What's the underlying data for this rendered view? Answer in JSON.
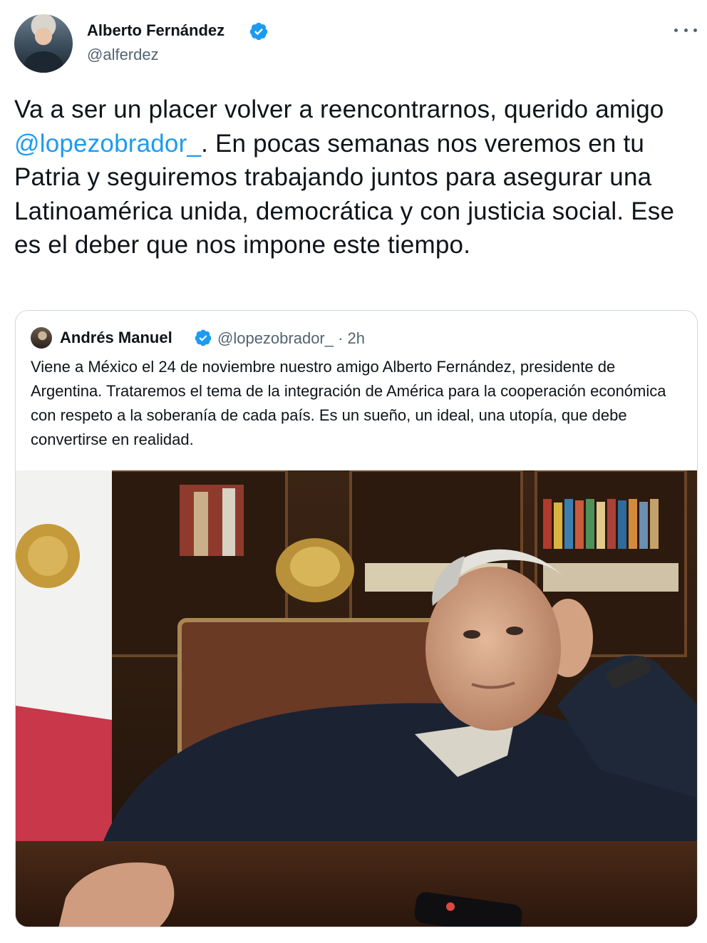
{
  "tweet": {
    "author_name": "Alberto Fernández",
    "author_handle": "@alferdez",
    "text_parts": {
      "before_mention": "Va a ser un placer volver a reencontrarnos, querido amigo ",
      "mention": "@lopezobrador_",
      "after_mention": ". En pocas semanas nos veremos en tu Patria y seguiremos trabajando juntos para asegurar una Latinoamérica unida, democrática y con justicia social. Ese es el deber que nos impone este tiempo."
    }
  },
  "quoted_tweet": {
    "author_name": "Andrés Manuel",
    "handle_time": "@lopezobrador_ · 2h",
    "text": "Viene a México el 24 de noviembre nuestro amigo Alberto Fernández, presidente de Argentina. Trataremos el tema de la integración de América para la cooperación económica con respeto a la soberanía de cada país. Es un sueño, un ideal, una utopía, que debe convertirse en realidad."
  },
  "icons": {
    "verified": "verified-badge-icon",
    "more": "more-options-icon"
  },
  "colors": {
    "accent": "#1d9bf0",
    "text": "#0f1419",
    "secondary": "#536471",
    "border": "#cfd9de"
  }
}
